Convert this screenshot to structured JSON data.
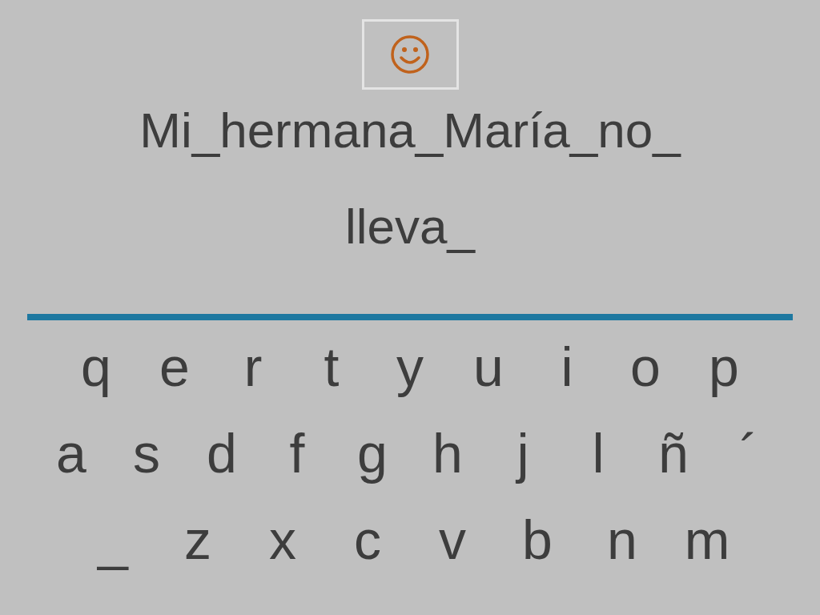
{
  "answer_lines": [
    "Mi_hermana_María_no_",
    "lleva_"
  ],
  "keyboard_rows": [
    [
      "q",
      "e",
      "r",
      "t",
      "y",
      "u",
      "i",
      "o",
      "p"
    ],
    [
      "a",
      "s",
      "d",
      "f",
      "g",
      "h",
      "j",
      "l",
      "ñ",
      "´"
    ],
    [
      "_",
      "z",
      "x",
      "c",
      "v",
      "b",
      "n",
      "m"
    ]
  ]
}
